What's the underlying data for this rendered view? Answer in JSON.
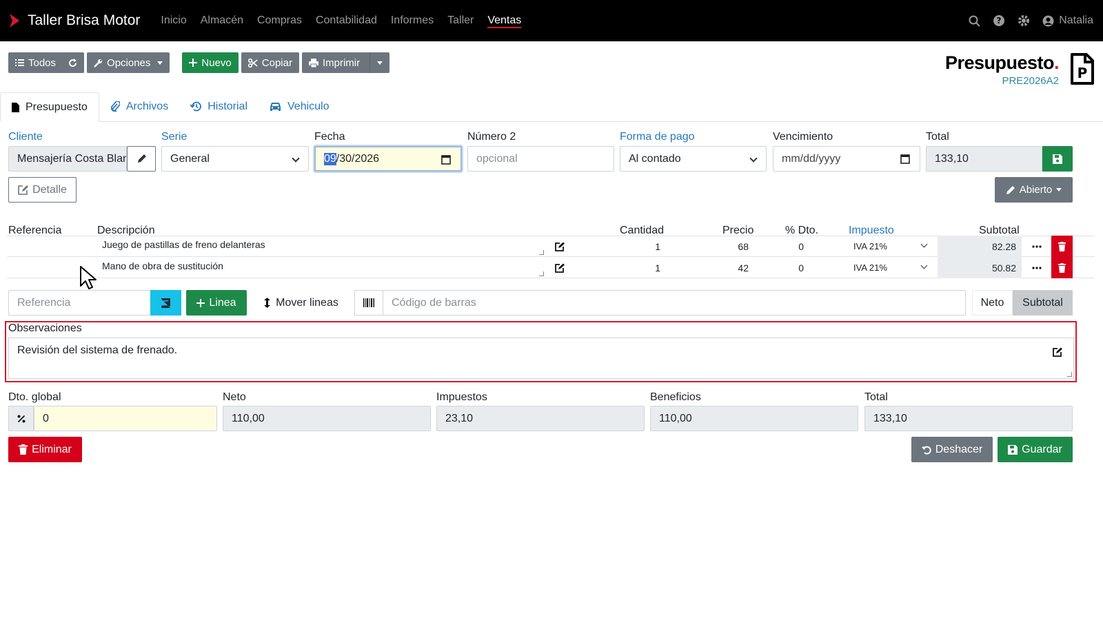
{
  "nav": {
    "brand": "Taller Brisa Motor",
    "items": [
      "Inicio",
      "Almacén",
      "Compras",
      "Contabilidad",
      "Informes",
      "Taller",
      "Ventas"
    ],
    "active": "Ventas",
    "user": "Natalia"
  },
  "toolbar": {
    "todos": "Todos",
    "opciones": "Opciones",
    "nuevo": "Nuevo",
    "copiar": "Copiar",
    "imprimir": "Imprimir"
  },
  "doc": {
    "title": "Presupuesto",
    "title_dot": ".",
    "code": "PRE2026A2"
  },
  "tabs": [
    "Presupuesto",
    "Archivos",
    "Historial",
    "Vehiculo"
  ],
  "form": {
    "cliente_label": "Cliente",
    "cliente_value": "Mensajería Costa Blanca",
    "serie_label": "Serie",
    "serie_value": "General",
    "fecha_label": "Fecha",
    "fecha_sel": "09",
    "fecha_rest": "/30/2026",
    "numero2_label": "Número 2",
    "numero2_placeholder": "opcional",
    "pago_label": "Forma de pago",
    "pago_value": "Al contado",
    "venc_label": "Vencimiento",
    "venc_placeholder": "mm/dd/yyyy",
    "total_label": "Total",
    "total_value": "133,10",
    "detalle_btn": "Detalle",
    "estado_btn": "Abierto"
  },
  "lines": {
    "headers": {
      "referencia": "Referencia",
      "descripcion": "Descripción",
      "cantidad": "Cantidad",
      "precio": "Precio",
      "dto": "% Dto.",
      "impuesto": "Impuesto",
      "subtotal": "Subtotal"
    },
    "rows": [
      {
        "referencia": "",
        "descripcion": "Juego de pastillas de freno delanteras",
        "cantidad": "1",
        "precio": "68",
        "dto": "0",
        "impuesto": "IVA 21%",
        "subtotal": "82.28"
      },
      {
        "referencia": "",
        "descripcion": "Mano de obra de sustitución",
        "cantidad": "1",
        "precio": "42",
        "dto": "0",
        "impuesto": "IVA 21%",
        "subtotal": "50.82"
      }
    ]
  },
  "addbar": {
    "referencia_placeholder": "Referencia",
    "linea_btn": "Linea",
    "mover_btn": "Mover lineas",
    "barcode_placeholder": "Código de barras",
    "neto_btn": "Neto",
    "subtotal_btn": "Subtotal"
  },
  "observaciones": {
    "label": "Observaciones",
    "value": "Revisión del sistema de frenado."
  },
  "totals": {
    "dto_label": "Dto. global",
    "dto_value": "0",
    "neto_label": "Neto",
    "neto_value": "110,00",
    "impuestos_label": "Impuestos",
    "impuestos_value": "23,10",
    "beneficios_label": "Beneficios",
    "beneficios_value": "110,00",
    "total_label": "Total",
    "total_value": "133,10"
  },
  "actions": {
    "eliminar": "Eliminar",
    "deshacer": "Deshacer",
    "guardar": "Guardar"
  },
  "colors": {
    "brand_red": "#d5192c",
    "success": "#1e8a4a",
    "secondary": "#6c757d",
    "link": "#2878b7",
    "info": "#17c1e8"
  }
}
